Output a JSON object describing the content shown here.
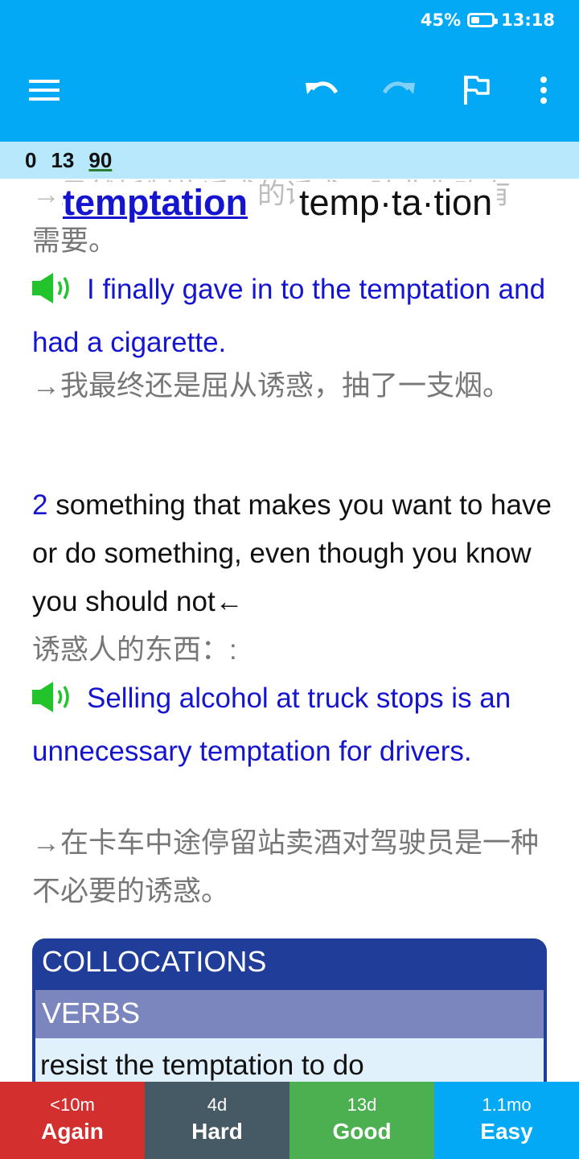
{
  "status_bar": {
    "battery": "45%",
    "time": "13:18"
  },
  "counts": {
    "new": "0",
    "learn": "13",
    "review": "90"
  },
  "entry": {
    "ghost_line": "→虽然抵制住诱惑的诱惑，除非你确有",
    "headword": "temptation",
    "pronunciation": "temp·ta·tion",
    "ghost_tail": "需要。",
    "example1": "I finally gave in to the temptation and had a cigarette.",
    "translation1": "→我最终还是屈从诱惑，抽了一支烟。",
    "sense_number": "2",
    "definition2": "something that makes you want to have or do something, even though you know you should not←",
    "definition2_cn": "诱惑人的东西：:",
    "example2": "Selling alcohol at truck stops is an unnecessary temptation for drivers.",
    "translation2": "→在卡车中途停留站卖酒对驾驶员是一种不必要的诱惑。"
  },
  "collocations": {
    "title": "COLLOCATIONS",
    "section": "VERBS",
    "first_item": "resist the temptation to do"
  },
  "answers": [
    {
      "interval": "<10m",
      "label": "Again"
    },
    {
      "interval": "4d",
      "label": "Hard"
    },
    {
      "interval": "13d",
      "label": "Good"
    },
    {
      "interval": "1.1mo",
      "label": "Easy"
    }
  ],
  "colors": {
    "app_bar": "#03a9f4",
    "again": "#d32f2f",
    "hard": "#455a64",
    "good": "#4caf50",
    "easy": "#03a9f4",
    "example_text": "#1515d0",
    "collocation_header": "#203d99"
  },
  "icons": {
    "menu": "hamburger-icon",
    "undo": "undo-icon",
    "redo": "redo-icon",
    "flag": "flag-icon",
    "more": "more-vertical-icon",
    "speaker": "speaker-icon"
  }
}
